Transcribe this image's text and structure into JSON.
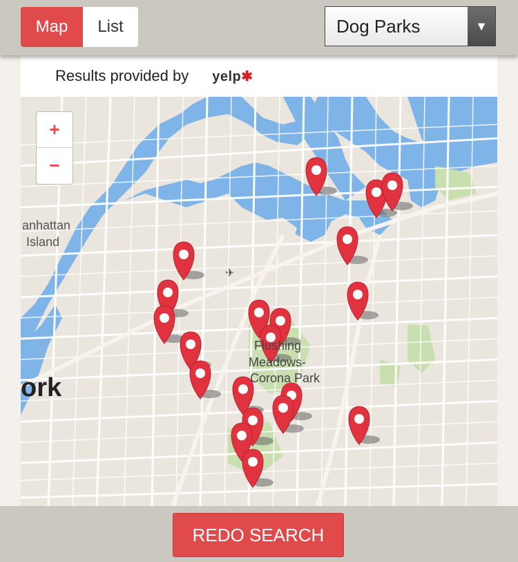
{
  "view_toggle": {
    "map_label": "Map",
    "list_label": "List"
  },
  "category_select": {
    "value": "Dog Parks"
  },
  "attribution": {
    "text": "Results provided by",
    "logo": "yelp"
  },
  "zoom": {
    "in": "+",
    "out": "−"
  },
  "map_labels": {
    "manhattan_line1": "anhattan",
    "manhattan_line2": "Island",
    "new_york": "ork",
    "flushing_line1": "Flushing",
    "flushing_line2": "Meadows-",
    "flushing_line3": "Corona Park"
  },
  "airport_icon": "airplane-icon",
  "marker_color": "#e0333f",
  "redo_button": {
    "label": "REDO SEARCH"
  }
}
